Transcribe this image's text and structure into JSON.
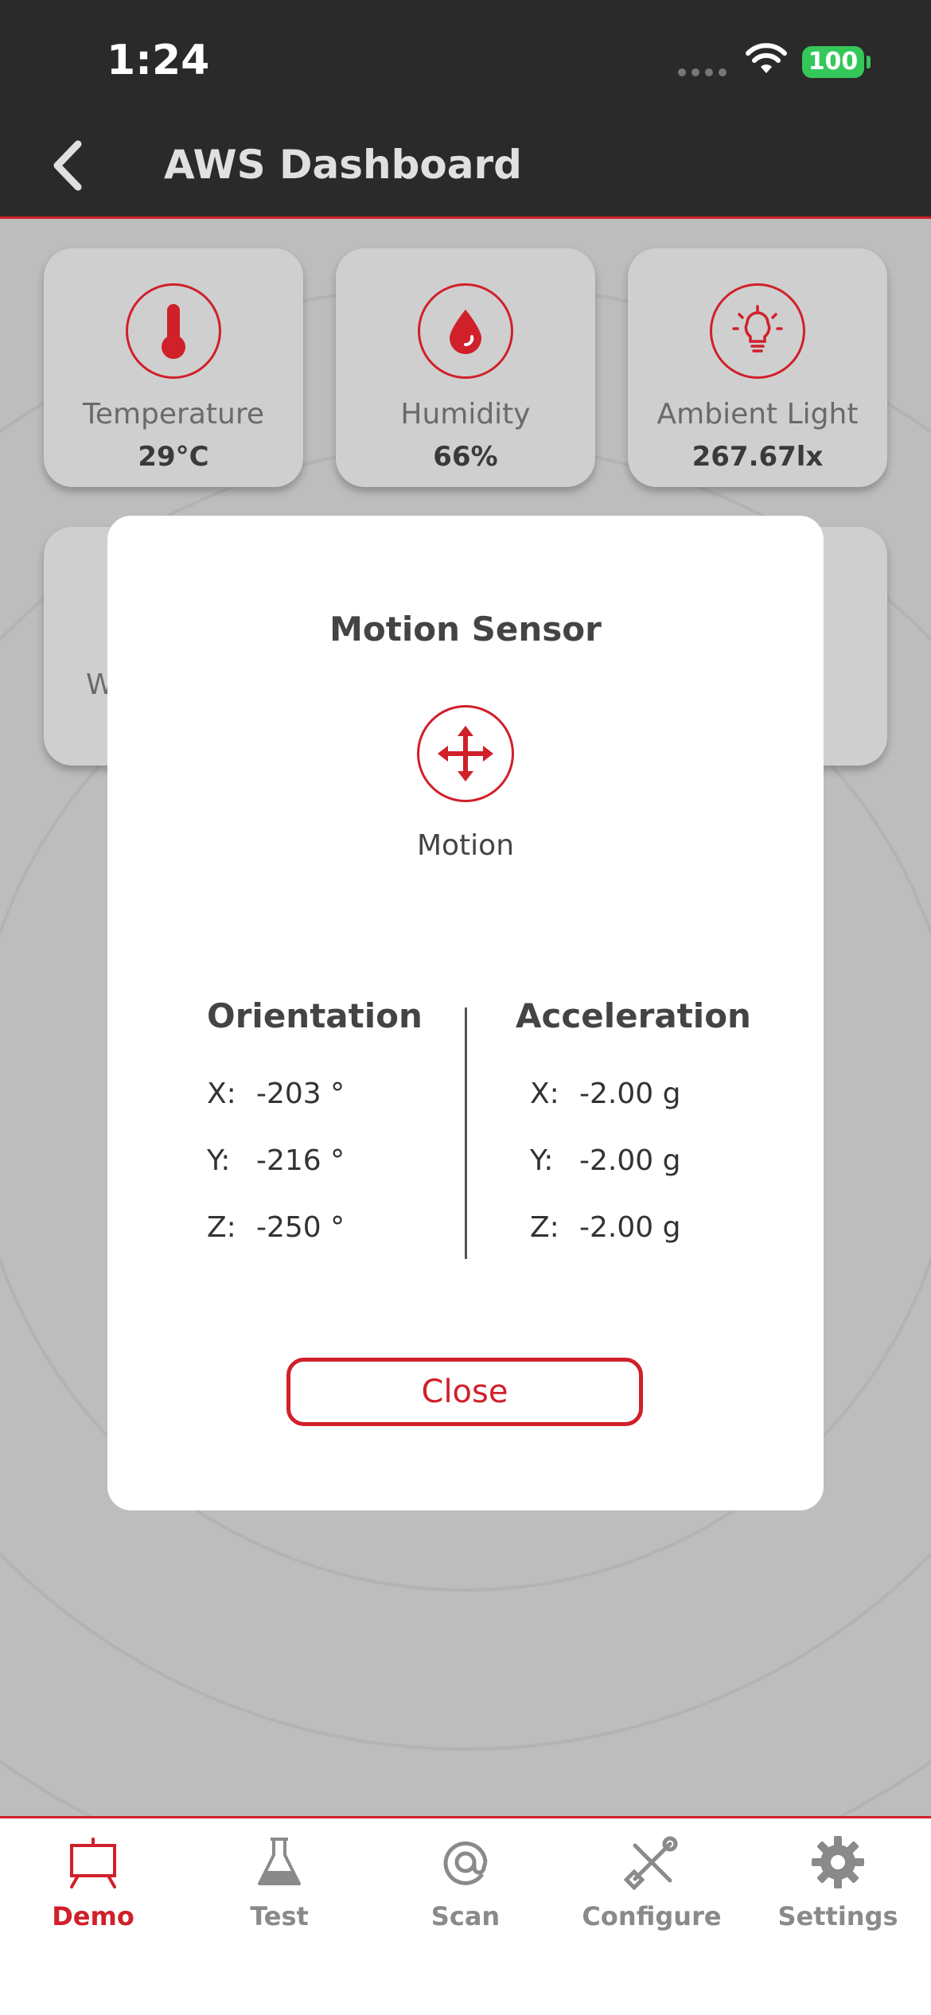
{
  "status_bar": {
    "time": "1:24",
    "battery": "100"
  },
  "header": {
    "title": "AWS Dashboard"
  },
  "cards": [
    {
      "label": "Temperature",
      "value": "29°C",
      "icon": "thermometer-icon"
    },
    {
      "label": "Humidity",
      "value": "66%",
      "icon": "water-drop-icon"
    },
    {
      "label": "Ambient Light",
      "value": "267.67lx",
      "icon": "light-bulb-icon"
    }
  ],
  "partial_card_text": "W",
  "modal": {
    "title": "Motion Sensor",
    "icon": "move-arrows-icon",
    "label": "Motion",
    "orientation": {
      "heading": "Orientation",
      "rows": [
        {
          "axis": "X:",
          "value": "-203 °"
        },
        {
          "axis": "Y:",
          "value": "-216 °"
        },
        {
          "axis": "Z:",
          "value": "-250 °"
        }
      ]
    },
    "acceleration": {
      "heading": "Acceleration",
      "rows": [
        {
          "axis": "X:",
          "value": "-2.00 g"
        },
        {
          "axis": "Y:",
          "value": "-2.00 g"
        },
        {
          "axis": "Z:",
          "value": "-2.00 g"
        }
      ]
    },
    "close_label": "Close"
  },
  "tabs": [
    {
      "label": "Demo",
      "icon": "easel-icon",
      "active": true
    },
    {
      "label": "Test",
      "icon": "flask-icon",
      "active": false
    },
    {
      "label": "Scan",
      "icon": "at-scan-icon",
      "active": false
    },
    {
      "label": "Configure",
      "icon": "tools-icon",
      "active": false
    },
    {
      "label": "Settings",
      "icon": "gear-icon",
      "active": false
    }
  ],
  "colors": {
    "accent": "#d0202a",
    "header_bg": "#2a2a2a",
    "backdrop": "#bdbdbd",
    "battery": "#34c759"
  }
}
